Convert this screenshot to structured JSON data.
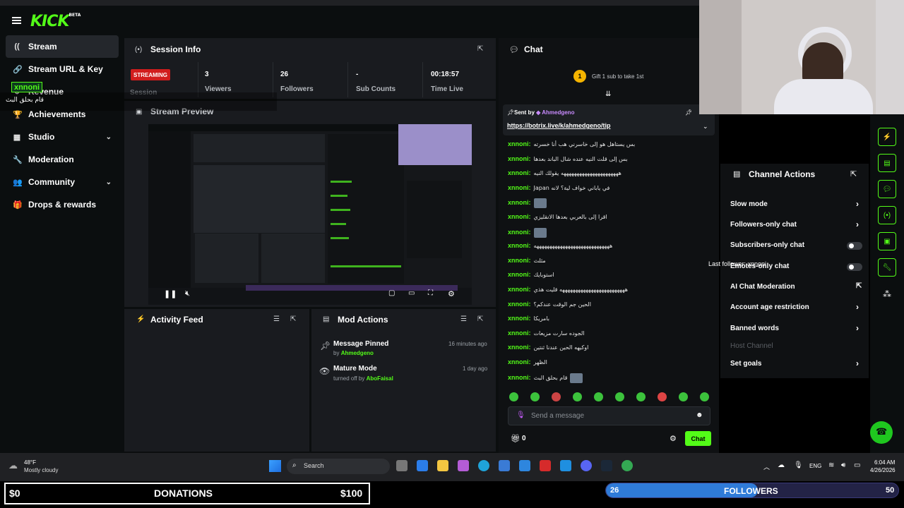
{
  "sidebar": {
    "items": [
      {
        "label": "Stream",
        "icon": "broadcast-icon",
        "active": true
      },
      {
        "label": "Stream URL & Key",
        "icon": "link-icon"
      },
      {
        "label": "Revenue",
        "icon": "money-icon"
      },
      {
        "label": "Achievements",
        "icon": "trophy-icon"
      },
      {
        "label": "Studio",
        "icon": "film-icon",
        "chevron": true
      },
      {
        "label": "Moderation",
        "icon": "wrench-icon"
      },
      {
        "label": "Community",
        "icon": "people-icon",
        "chevron": true
      },
      {
        "label": "Drops & rewards",
        "icon": "gift-icon"
      }
    ],
    "popup_user": "xnnoni",
    "popup_msg": "قام بحلق البث"
  },
  "session": {
    "title": "Session Info",
    "status": "STREAMING",
    "session_label": "Session",
    "stats": [
      {
        "value": "3",
        "label": "Viewers"
      },
      {
        "value": "26",
        "label": "Followers"
      },
      {
        "value": "-",
        "label": "Sub Counts"
      },
      {
        "value": "00:18:57",
        "label": "Time Live"
      }
    ]
  },
  "preview": {
    "title": "Stream Preview"
  },
  "activity": {
    "title": "Activity Feed"
  },
  "mod_actions": {
    "title": "Mod Actions",
    "items": [
      {
        "title": "Message Pinned",
        "by_prefix": "by",
        "by": "Ahmedgeno",
        "time": "16 minutes ago"
      },
      {
        "title": "Mature Mode",
        "by_prefix": "turned off by",
        "by": "AboFaisal",
        "time": "1 day ago"
      }
    ]
  },
  "chat": {
    "title": "Chat",
    "gift_text": "Gift 1 sub to take 1st",
    "gift_count": "1",
    "pinned_prefix": "Sent by",
    "pinned_user": "Ahmedgeno",
    "pinned_link": "https://botrix.live/k/ahmedgeno/tip",
    "messages": [
      {
        "user": "xnnoni:",
        "msg": "بس يستاهل هو إلى خاسرني هب أنا خسرته"
      },
      {
        "user": "xnnoni:",
        "msg": "بس إلى قلت النيه عنده شال الباند بعدها"
      },
      {
        "user": "xnnoni:",
        "msg": "ههههههههههههههههههههههه يقولك النيه"
      },
      {
        "user": "xnnoni:",
        "msg": "Japan في ياباني خواف لية؟ لانه"
      },
      {
        "user": "xnnoni:",
        "msg": "",
        "emote": true
      },
      {
        "user": "xnnoni:",
        "msg": "اقرا إلى بالعربي بعدها الانقليزي"
      },
      {
        "user": "xnnoni:",
        "msg": "",
        "emote": true
      },
      {
        "user": "xnnoni:",
        "msg": "هههههههههههههههههههههههههههههه"
      },
      {
        "user": "xnnoni:",
        "msg": "مثلث"
      },
      {
        "user": "xnnoni:",
        "msg": "استوبايك"
      },
      {
        "user": "xnnoni:",
        "msg": "هههههههههههههههههههههههههه قليت هذي"
      },
      {
        "user": "xnnoni:",
        "msg": "الحين جم الوقت عندكم؟"
      },
      {
        "user": "xnnoni:",
        "msg": "بامريكا"
      },
      {
        "user": "xnnoni:",
        "msg": "الجوده سارت مزيعات"
      },
      {
        "user": "xnnoni:",
        "msg": "اوكيهه الحين عندنا ثنتين"
      },
      {
        "user": "xnnoni:",
        "msg": "الظهر"
      },
      {
        "user": "xnnoni:",
        "msg": "قام بحلق البث",
        "emote": true
      }
    ],
    "input_placeholder": "Send a message",
    "points": "0",
    "send_label": "Chat"
  },
  "channel_actions": {
    "title": "Channel Actions",
    "items": [
      {
        "label": "Slow mode",
        "control": "chevron"
      },
      {
        "label": "Followers-only chat",
        "control": "chevron"
      },
      {
        "label": "Subscribers-only chat",
        "control": "toggle"
      },
      {
        "label": "Emotes-only chat",
        "control": "toggle"
      },
      {
        "label": "AI Chat Moderation",
        "control": "external"
      },
      {
        "label": "Account age restriction",
        "control": "chevron"
      },
      {
        "label": "Banned words",
        "control": "chevron"
      },
      {
        "label": "Host Channel",
        "control": "none",
        "disabled": true
      },
      {
        "label": "Set goals",
        "control": "chevron"
      }
    ],
    "overlay_text": "Last follower: xnnoni"
  },
  "taskbar": {
    "weather_temp": "48°F",
    "weather_desc": "Mostly cloudy",
    "search_label": "Search",
    "lang": "ENG",
    "time": "6:04 AM",
    "date": "4/26/2026"
  },
  "donations": {
    "left": "$0",
    "label": "DONATIONS",
    "right": "$100"
  },
  "followers_goal": {
    "current": "26",
    "label": "FOLLOWERS",
    "target": "50",
    "progress": 0.52
  },
  "colors": {
    "kick_green": "#53fc18",
    "streaming_red": "#d11d1d",
    "panel": "#191b1f",
    "bg": "#0b0e0f"
  }
}
